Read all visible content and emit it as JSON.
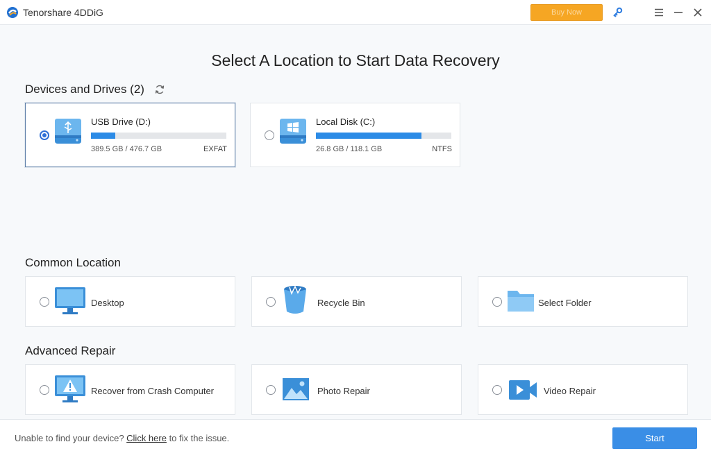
{
  "app": {
    "title": "Tenorshare 4DDiG",
    "buy_label": "Buy Now",
    "icons": [
      "app-logo-icon",
      "key-icon",
      "menu-icon",
      "minimize-icon",
      "close-icon"
    ]
  },
  "page": {
    "title": "Select A Location to Start Data Recovery"
  },
  "devices": {
    "title": "Devices and Drives (2)",
    "refresh_icon": "refresh-icon",
    "items": [
      {
        "name": "USB Drive (D:)",
        "size": "389.5 GB / 476.7 GB",
        "fs": "EXFAT",
        "usage": 0.18,
        "selected": true,
        "icon": "usb-drive-icon"
      },
      {
        "name": "Local Disk (C:)",
        "size": "26.8 GB / 118.1 GB",
        "fs": "NTFS",
        "usage": 0.78,
        "selected": false,
        "icon": "windows-disk-icon"
      }
    ]
  },
  "common": {
    "title": "Common Location",
    "items": [
      {
        "label": "Desktop",
        "icon": "monitor-icon"
      },
      {
        "label": "Recycle Bin",
        "icon": "recycle-bin-icon"
      },
      {
        "label": "Select Folder",
        "icon": "folder-icon"
      }
    ]
  },
  "advanced": {
    "title": "Advanced Repair",
    "items": [
      {
        "label": "Recover from Crash Computer",
        "icon": "crash-computer-icon"
      },
      {
        "label": "Photo Repair",
        "icon": "photo-icon"
      },
      {
        "label": "Video Repair",
        "icon": "video-camera-icon"
      }
    ]
  },
  "footer": {
    "text_before": "Unable to find your device? ",
    "link": "Click here",
    "text_after": " to fix the issue.",
    "start_label": "Start"
  },
  "colors": {
    "accent": "#2f6fd6",
    "buy_button": "#f6a623",
    "start_button": "#3a8ee6",
    "bar_fill": "#2c8be6"
  }
}
